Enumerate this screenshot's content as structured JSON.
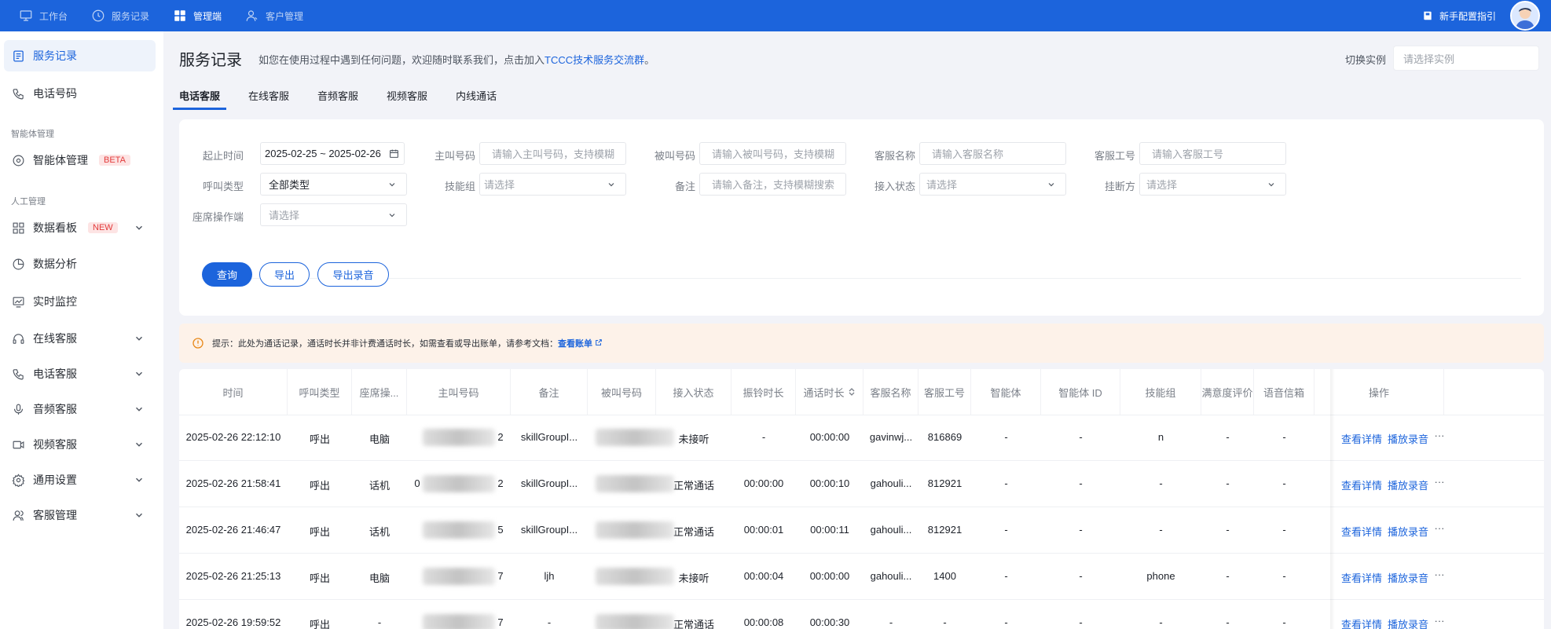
{
  "topnav": {
    "items": [
      {
        "label": "工作台",
        "icon": "monitor-icon",
        "active": false
      },
      {
        "label": "服务记录",
        "icon": "clock-icon",
        "active": false
      },
      {
        "label": "管理端",
        "icon": "grid-icon",
        "active": true
      },
      {
        "label": "客户管理",
        "icon": "user-icon",
        "active": false
      }
    ],
    "guide_label": "新手配置指引"
  },
  "sidebar": {
    "items": [
      {
        "label": "服务记录",
        "icon": "document-icon",
        "active": true
      },
      {
        "label": "电话号码",
        "icon": "phone-icon"
      }
    ],
    "group_ai": "智能体管理",
    "ai_item": {
      "label": "智能体管理",
      "badge": "BETA",
      "icon": "agent-icon"
    },
    "group_manual": "人工管理",
    "manual_items": [
      {
        "label": "数据看板",
        "badge": "NEW",
        "icon": "dashboard-icon",
        "expand": true
      },
      {
        "label": "数据分析",
        "icon": "pie-chart-icon",
        "expand": false
      },
      {
        "label": "实时监控",
        "icon": "monitor-chart-icon",
        "expand": false
      },
      {
        "label": "在线客服",
        "icon": "headset-icon",
        "expand": true
      },
      {
        "label": "电话客服",
        "icon": "phone-icon",
        "expand": true
      },
      {
        "label": "音频客服",
        "icon": "microphone-icon",
        "expand": true
      },
      {
        "label": "视频客服",
        "icon": "video-icon",
        "expand": true
      },
      {
        "label": "通用设置",
        "icon": "gear-icon",
        "expand": true
      },
      {
        "label": "客服管理",
        "icon": "people-icon",
        "expand": true
      }
    ]
  },
  "header": {
    "title": "服务记录",
    "desc_prefix": "如您在使用过程中遇到任何问题，欢迎随时联系我们，点击加入",
    "desc_link": "TCCC技术服务交流群",
    "desc_suffix": "。",
    "switch_label": "切换实例",
    "switch_placeholder": "请选择实例"
  },
  "tabs": [
    "电话客服",
    "在线客服",
    "音频客服",
    "视频客服",
    "内线通话"
  ],
  "filters": {
    "date_label": "起止时间",
    "date_value": "2025-02-25 ~ 2025-02-26",
    "caller_label": "主叫号码",
    "caller_placeholder": "请输入主叫号码，支持模糊",
    "callee_label": "被叫号码",
    "callee_placeholder": "请输入被叫号码，支持模糊",
    "agent_name_label": "客服名称",
    "agent_name_placeholder": "请输入客服名称",
    "agent_id_label": "客服工号",
    "agent_id_placeholder": "请输入客服工号",
    "call_type_label": "呼叫类型",
    "call_type_value": "全部类型",
    "skill_label": "技能组",
    "skill_placeholder": "请选择",
    "remark_label": "备注",
    "remark_placeholder": "请输入备注，支持模糊搜索",
    "status_label": "接入状态",
    "status_placeholder": "请选择",
    "hangup_label": "挂断方",
    "hangup_placeholder": "请选择",
    "seat_label": "座席操作端",
    "seat_placeholder": "请选择",
    "query_button": "查询",
    "export_button": "导出",
    "export_audio_button": "导出录音"
  },
  "notice": {
    "text": "提示：此处为通话记录，通话时长并非计费通话时长，如需查看或导出账单，请参考文档：",
    "link": "查看账单"
  },
  "table": {
    "columns": [
      "时间",
      "呼叫类型",
      "座席操...",
      "主叫号码",
      "备注",
      "被叫号码",
      "接入状态",
      "振铃时长",
      "通话时长",
      "客服名称",
      "客服工号",
      "智能体",
      "智能体 ID",
      "技能组",
      "满意度评价",
      "语音信箱",
      "操作"
    ],
    "rows": [
      {
        "time": "2025-02-26 22:12:10",
        "type": "呼出",
        "seat": "电脑",
        "caller_tail": "2",
        "remark": "skillGroupI...",
        "status": "未接听",
        "ring": "-",
        "duration": "00:00:00",
        "agent": "gavinwj...",
        "agent_id": "816869",
        "ai": "-",
        "ai_id": "-",
        "skill": "n",
        "sat": "-",
        "voicemail": "-"
      },
      {
        "time": "2025-02-26 21:58:41",
        "type": "呼出",
        "seat": "话机",
        "caller_tail": "2",
        "caller_head": "0",
        "remark": "skillGroupI...",
        "status": "正常通话",
        "ring": "00:00:00",
        "duration": "00:00:10",
        "agent": "gahouli...",
        "agent_id": "812921",
        "ai": "-",
        "ai_id": "-",
        "skill": "-",
        "sat": "-",
        "voicemail": "-"
      },
      {
        "time": "2025-02-26 21:46:47",
        "type": "呼出",
        "seat": "话机",
        "caller_tail": "5",
        "remark": "skillGroupI...",
        "status": "正常通话",
        "ring": "00:00:01",
        "duration": "00:00:11",
        "agent": "gahouli...",
        "agent_id": "812921",
        "ai": "-",
        "ai_id": "-",
        "skill": "-",
        "sat": "-",
        "voicemail": "-"
      },
      {
        "time": "2025-02-26 21:25:13",
        "type": "呼出",
        "seat": "电脑",
        "caller_tail": "7",
        "remark": "ljh",
        "status": "未接听",
        "ring": "00:00:04",
        "duration": "00:00:00",
        "agent": "gahouli...",
        "agent_id": "1400",
        "ai": "-",
        "ai_id": "-",
        "skill": "phone",
        "sat": "-",
        "voicemail": "-"
      },
      {
        "time": "2025-02-26 19:59:52",
        "type": "呼出",
        "seat": "-",
        "caller_tail": "7",
        "remark": "-",
        "status": "正常通话",
        "ring": "00:00:08",
        "duration": "00:00:30",
        "agent": "-",
        "agent_id": "-",
        "ai": "-",
        "ai_id": "-",
        "skill": "-",
        "sat": "-",
        "voicemail": "-"
      }
    ],
    "action_detail": "查看详情",
    "action_play": "播放录音",
    "action_more": "···"
  },
  "colors": {
    "primary": "#1c64dc",
    "topbar": "#1c64dc",
    "notice_bg": "#fdf2e9",
    "badge_red": "#e23b3b"
  }
}
